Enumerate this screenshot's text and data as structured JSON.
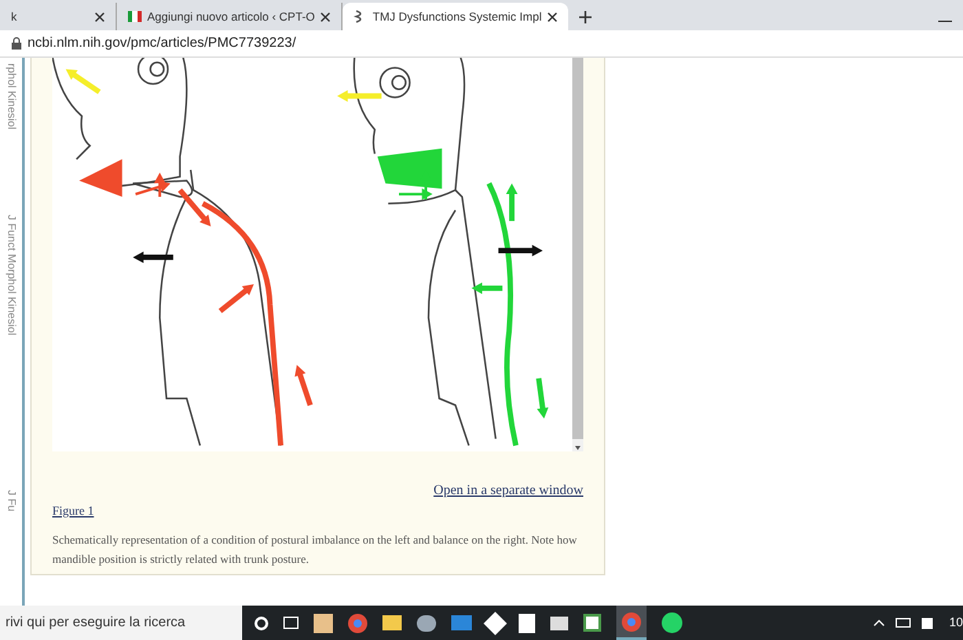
{
  "browser": {
    "tabs": [
      {
        "title": "k",
        "selected": false
      },
      {
        "title": "Aggiungi nuovo articolo ‹ CPT-O",
        "selected": false
      },
      {
        "title": "TMJ Dysfunctions Systemic Impl",
        "selected": true
      }
    ],
    "address": "ncbi.nlm.nih.gov/pmc/articles/PMC7739223/"
  },
  "sidebar_tabs": [
    "rphol Kinesiol",
    "J Funct Morphol Kinesiol",
    "J Fu"
  ],
  "figure": {
    "link": "Open in a separate window",
    "label": "Figure 1",
    "caption": "Schematically representation of a condition of postural imbalance on the left and balance on the right. Note how mandible position is strictly related with trunk posture."
  },
  "taskbar": {
    "search_placeholder": "rivi qui per eseguire la ricerca",
    "clock": "10"
  }
}
